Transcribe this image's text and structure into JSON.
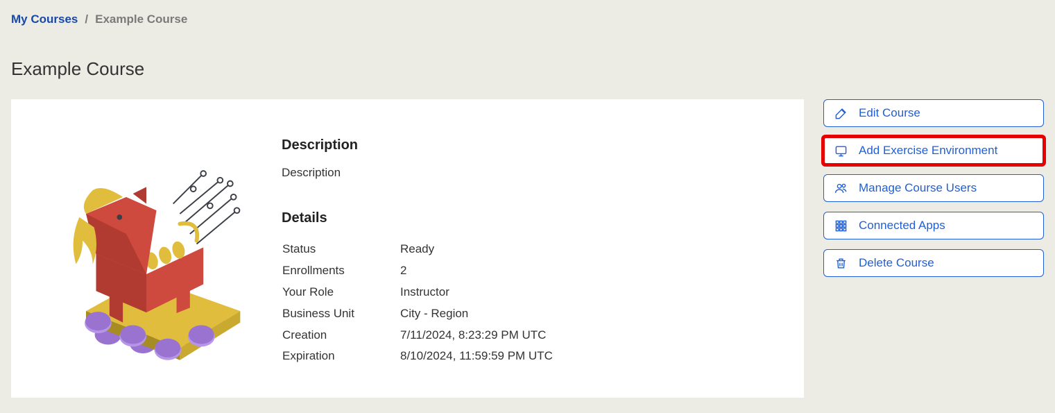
{
  "breadcrumb": {
    "root": "My Courses",
    "sep": "/",
    "current": "Example Course"
  },
  "page_title": "Example Course",
  "description": {
    "heading": "Description",
    "text": "Description"
  },
  "details": {
    "heading": "Details",
    "rows": {
      "status": {
        "label": "Status",
        "value": "Ready"
      },
      "enrollments": {
        "label": "Enrollments",
        "value": "2"
      },
      "role": {
        "label": "Your Role",
        "value": "Instructor"
      },
      "bu": {
        "label": "Business Unit",
        "value": "City - Region"
      },
      "creation": {
        "label": "Creation",
        "value": "7/11/2024, 8:23:29 PM UTC"
      },
      "expiration": {
        "label": "Expiration",
        "value": "8/10/2024, 11:59:59 PM UTC"
      }
    }
  },
  "actions": {
    "edit": "Edit Course",
    "add_env": "Add Exercise Environment",
    "manage_users": "Manage Course Users",
    "connected_apps": "Connected Apps",
    "delete": "Delete Course"
  }
}
